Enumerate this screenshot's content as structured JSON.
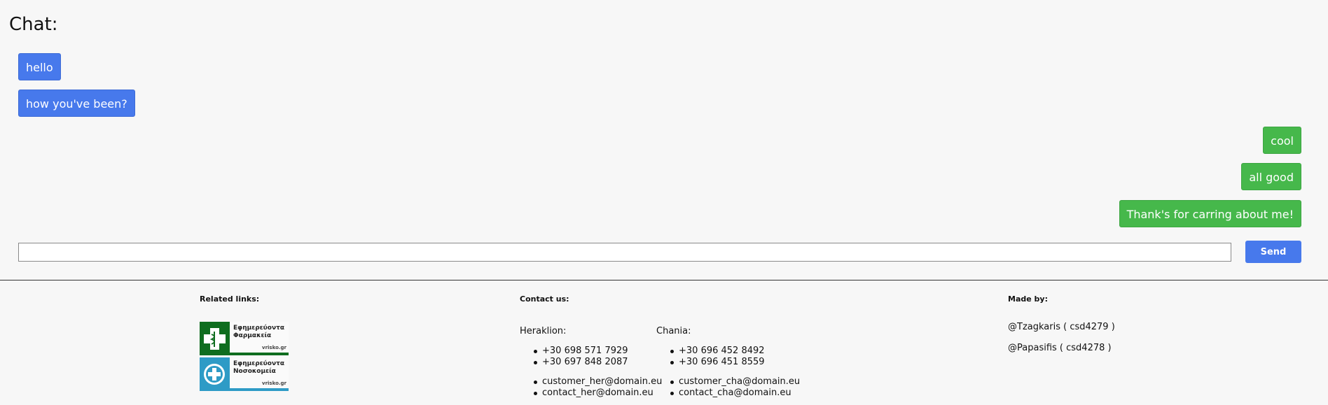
{
  "chat": {
    "title": "Chat:",
    "messages_left": [
      "hello",
      "how you've been?"
    ],
    "messages_right": [
      "cool",
      "all good",
      "Thank's for carring about me!"
    ],
    "input_value": "",
    "send_label": "Send"
  },
  "colors": {
    "left_bubble": "#4779ec",
    "right_bubble": "#46b84b",
    "send": "#4779ec"
  },
  "footer": {
    "related": {
      "heading": "Related links:",
      "logos": [
        {
          "text": "Εφημερεύοντα\nΦαρμακεία",
          "brand": "vrisko.gr",
          "icon": "pharmacy-icon",
          "color": "#0f6d1f"
        },
        {
          "text": "Εφημερεύοντα\nΝοσοκομεία",
          "brand": "vrisko.gr",
          "icon": "hospital-icon",
          "color": "#2e9bc6"
        }
      ]
    },
    "contact": {
      "heading": "Contact us:",
      "heraklion": {
        "city": "Heraklion:",
        "phones": [
          "+30 698 571 7929",
          "+30 697 848 2087"
        ],
        "emails": [
          "customer_her@domain.eu",
          "contact_her@domain.eu"
        ]
      },
      "chania": {
        "city": "Chania:",
        "phones": [
          "+30 696 452 8492",
          "+30 696 451 8559"
        ],
        "emails": [
          "customer_cha@domain.eu",
          "contact_cha@domain.eu"
        ]
      }
    },
    "made_by": {
      "heading": "Made by:",
      "authors": [
        "@Tzagkaris ( csd4279 )",
        "@Papasifis ( csd4278 )"
      ]
    }
  }
}
